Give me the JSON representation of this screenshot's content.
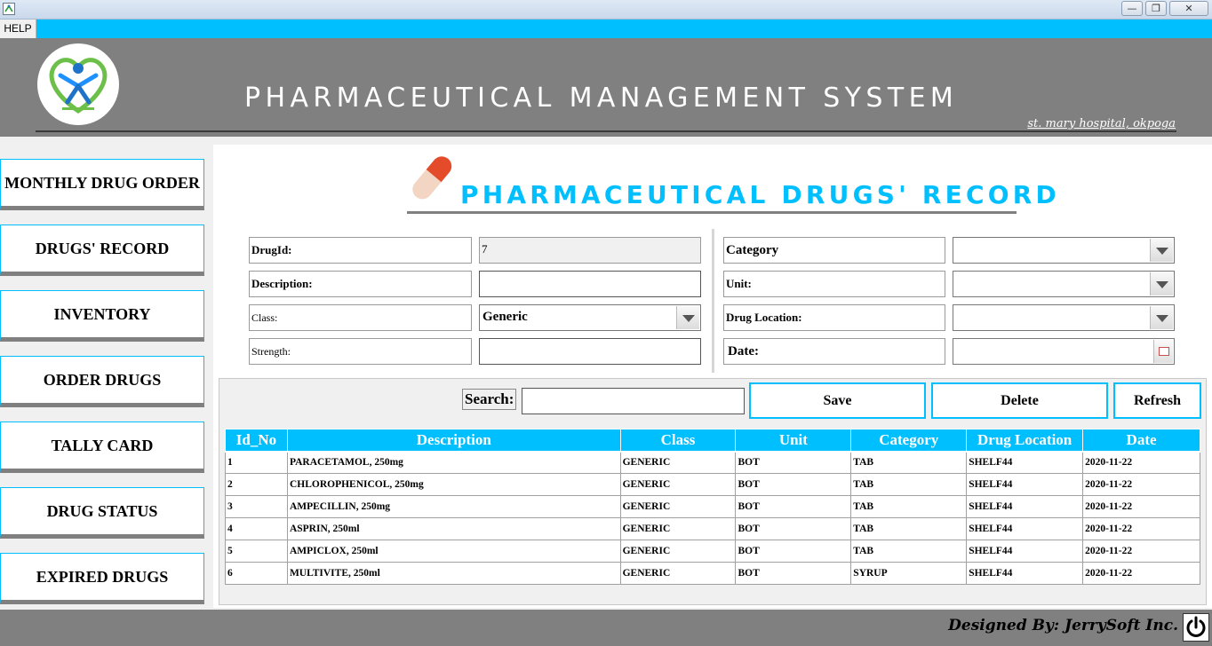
{
  "window": {
    "icon": "app-icon",
    "controls": {
      "minimize": "—",
      "maximize": "❐",
      "close": "✕"
    }
  },
  "menu": {
    "help": "HELP"
  },
  "header": {
    "logo": "hospital-logo",
    "title": "PHARMACEUTICAL MANAGEMENT SYSTEM",
    "hospital": "st. mary hospital, okpoga"
  },
  "sidebar": {
    "items": [
      {
        "label": "MONTHLY DRUG ORDER"
      },
      {
        "label": "DRUGS' RECORD"
      },
      {
        "label": "INVENTORY"
      },
      {
        "label": "ORDER DRUGS"
      },
      {
        "label": "TALLY CARD"
      },
      {
        "label": "DRUG STATUS"
      },
      {
        "label": "EXPIRED DRUGS"
      }
    ]
  },
  "form": {
    "title": "PHARMACEUTICAL DRUGS' RECORD",
    "fields": {
      "drug_id": {
        "label": "DrugId:",
        "value": "7"
      },
      "description": {
        "label": "Description:",
        "value": ""
      },
      "class": {
        "label": "Class:",
        "value": "Generic"
      },
      "strength": {
        "label": "Strength:",
        "value": ""
      },
      "category": {
        "label": "Category",
        "value": ""
      },
      "unit": {
        "label": "Unit:",
        "value": ""
      },
      "drug_location": {
        "label": "Drug Location:",
        "value": ""
      },
      "date": {
        "label": "Date:",
        "value": ""
      }
    }
  },
  "actions": {
    "search_label": "Search:",
    "search_value": "",
    "save": "Save",
    "delete": "Delete",
    "refresh": "Refresh"
  },
  "table": {
    "columns": [
      "Id_No",
      "Description",
      "Class",
      "Unit",
      "Category",
      "Drug Location",
      "Date"
    ],
    "rows": [
      [
        "1",
        "PARACETAMOL, 250mg",
        "GENERIC",
        "BOT",
        "TAB",
        "SHELF44",
        "2020-11-22"
      ],
      [
        "2",
        "CHLOROPHENICOL, 250mg",
        "GENERIC",
        "BOT",
        "TAB",
        "SHELF44",
        "2020-11-22"
      ],
      [
        "3",
        "AMPECILLIN, 250mg",
        "GENERIC",
        "BOT",
        "TAB",
        "SHELF44",
        "2020-11-22"
      ],
      [
        "4",
        "ASPRIN, 250ml",
        "GENERIC",
        "BOT",
        "TAB",
        "SHELF44",
        "2020-11-22"
      ],
      [
        "5",
        "AMPICLOX, 250ml",
        "GENERIC",
        "BOT",
        "TAB",
        "SHELF44",
        "2020-11-22"
      ],
      [
        "6",
        "MULTIVITE, 250ml",
        "GENERIC",
        "BOT",
        "SYRUP",
        "SHELF44",
        "2020-11-22"
      ]
    ]
  },
  "footer": {
    "credit": "Designed By: JerrySoft Inc."
  },
  "colors": {
    "accent": "#00bfff",
    "header": "#808080",
    "pill_red": "#e34b2b",
    "pill_cream": "#f2d6c3"
  }
}
